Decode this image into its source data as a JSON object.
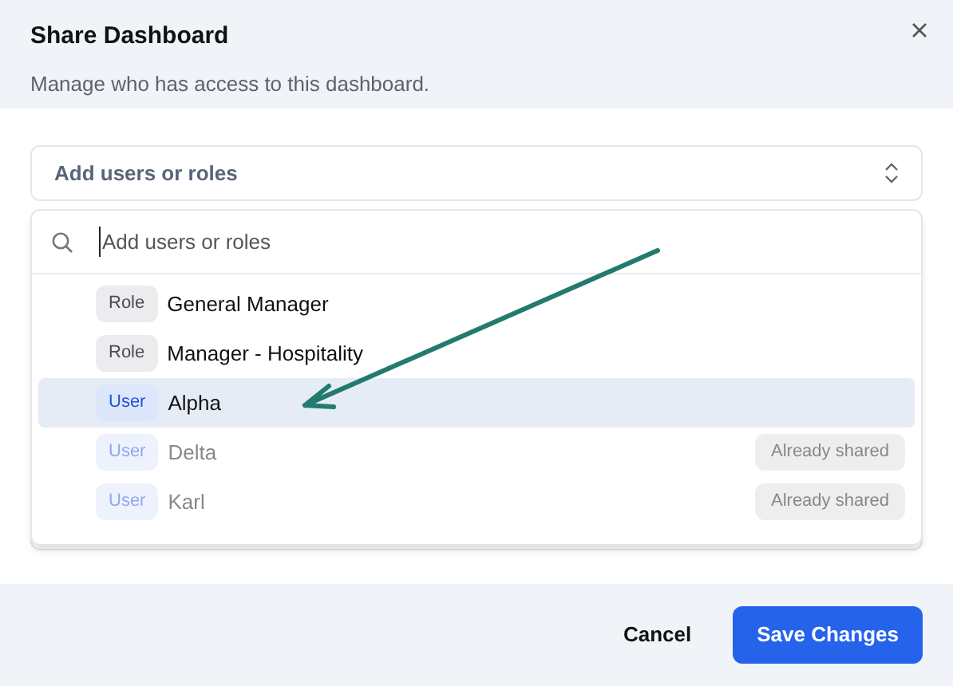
{
  "dialog": {
    "title": "Share Dashboard",
    "subtitle": "Manage who has access to this dashboard."
  },
  "select": {
    "placeholder": "Add users or roles"
  },
  "search": {
    "placeholder": "Add users or roles"
  },
  "options": [
    {
      "kind": "role",
      "tag": "Role",
      "name": "General Manager",
      "selected": false,
      "disabled": false
    },
    {
      "kind": "role",
      "tag": "Role",
      "name": "Manager - Hospitality",
      "selected": false,
      "disabled": false
    },
    {
      "kind": "user",
      "tag": "User",
      "name": "Alpha",
      "selected": true,
      "disabled": false
    },
    {
      "kind": "user",
      "tag": "User",
      "name": "Delta",
      "selected": false,
      "disabled": true,
      "note": "Already shared"
    },
    {
      "kind": "user",
      "tag": "User",
      "name": "Karl",
      "selected": false,
      "disabled": true,
      "note": "Already shared"
    }
  ],
  "buttons": {
    "cancel": "Cancel",
    "save": "Save Changes"
  }
}
